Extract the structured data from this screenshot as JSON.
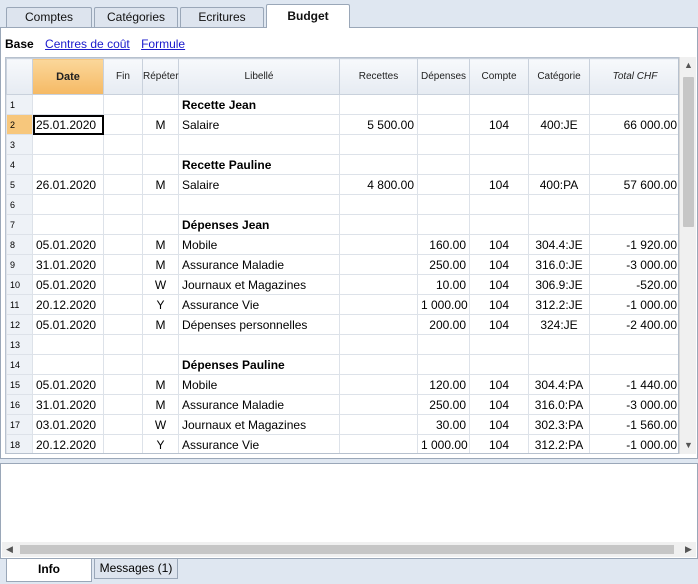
{
  "tabs": [
    "Comptes",
    "Catégories",
    "Ecritures",
    "Budget"
  ],
  "subnav": {
    "base": "Base",
    "links": [
      "Centres de coût",
      "Formule"
    ]
  },
  "columns": {
    "date": "Date",
    "fin": "Fin",
    "repeter": "Répéter",
    "libelle": "Libellé",
    "recettes": "Recettes",
    "depenses": "Dépenses",
    "compte": "Compte",
    "categorie": "Catégorie",
    "total": "Total CHF"
  },
  "rows": [
    {
      "n": "1",
      "date": "",
      "rep": "",
      "lib": "Recette Jean",
      "rec": "",
      "dep": "",
      "cpt": "",
      "cat": "",
      "tot": "",
      "head": true
    },
    {
      "n": "2",
      "date": "25.01.2020",
      "rep": "M",
      "lib": "Salaire",
      "rec": "5 500.00",
      "dep": "",
      "cpt": "104",
      "cat": "400:JE",
      "tot": "66 000.00"
    },
    {
      "n": "3",
      "date": "",
      "rep": "",
      "lib": "",
      "rec": "",
      "dep": "",
      "cpt": "",
      "cat": "",
      "tot": ""
    },
    {
      "n": "4",
      "date": "",
      "rep": "",
      "lib": "Recette Pauline",
      "rec": "",
      "dep": "",
      "cpt": "",
      "cat": "",
      "tot": "",
      "head": true
    },
    {
      "n": "5",
      "date": "26.01.2020",
      "rep": "M",
      "lib": "Salaire",
      "rec": "4 800.00",
      "dep": "",
      "cpt": "104",
      "cat": "400:PA",
      "tot": "57 600.00"
    },
    {
      "n": "6",
      "date": "",
      "rep": "",
      "lib": "",
      "rec": "",
      "dep": "",
      "cpt": "",
      "cat": "",
      "tot": ""
    },
    {
      "n": "7",
      "date": "",
      "rep": "",
      "lib": "Dépenses Jean",
      "rec": "",
      "dep": "",
      "cpt": "",
      "cat": "",
      "tot": "",
      "head": true
    },
    {
      "n": "8",
      "date": "05.01.2020",
      "rep": "M",
      "lib": "Mobile",
      "rec": "",
      "dep": "160.00",
      "cpt": "104",
      "cat": "304.4:JE",
      "tot": "-1 920.00"
    },
    {
      "n": "9",
      "date": "31.01.2020",
      "rep": "M",
      "lib": "Assurance Maladie",
      "rec": "",
      "dep": "250.00",
      "cpt": "104",
      "cat": "316.0:JE",
      "tot": "-3 000.00"
    },
    {
      "n": "10",
      "date": "05.01.2020",
      "rep": "W",
      "lib": "Journaux et Magazines",
      "rec": "",
      "dep": "10.00",
      "cpt": "104",
      "cat": "306.9:JE",
      "tot": "-520.00"
    },
    {
      "n": "11",
      "date": "20.12.2020",
      "rep": "Y",
      "lib": "Assurance Vie",
      "rec": "",
      "dep": "1 000.00",
      "cpt": "104",
      "cat": "312.2:JE",
      "tot": "-1 000.00"
    },
    {
      "n": "12",
      "date": "05.01.2020",
      "rep": "M",
      "lib": "Dépenses personnelles",
      "rec": "",
      "dep": "200.00",
      "cpt": "104",
      "cat": "324:JE",
      "tot": "-2 400.00"
    },
    {
      "n": "13",
      "date": "",
      "rep": "",
      "lib": "",
      "rec": "",
      "dep": "",
      "cpt": "",
      "cat": "",
      "tot": ""
    },
    {
      "n": "14",
      "date": "",
      "rep": "",
      "lib": "Dépenses Pauline",
      "rec": "",
      "dep": "",
      "cpt": "",
      "cat": "",
      "tot": "",
      "head": true
    },
    {
      "n": "15",
      "date": "05.01.2020",
      "rep": "M",
      "lib": "Mobile",
      "rec": "",
      "dep": "120.00",
      "cpt": "104",
      "cat": "304.4:PA",
      "tot": "-1 440.00"
    },
    {
      "n": "16",
      "date": "31.01.2020",
      "rep": "M",
      "lib": "Assurance Maladie",
      "rec": "",
      "dep": "250.00",
      "cpt": "104",
      "cat": "316.0:PA",
      "tot": "-3 000.00"
    },
    {
      "n": "17",
      "date": "03.01.2020",
      "rep": "W",
      "lib": "Journaux et Magazines",
      "rec": "",
      "dep": "30.00",
      "cpt": "104",
      "cat": "302.3:PA",
      "tot": "-1 560.00"
    },
    {
      "n": "18",
      "date": "20.12.2020",
      "rep": "Y",
      "lib": "Assurance Vie",
      "rec": "",
      "dep": "1 000.00",
      "cpt": "104",
      "cat": "312.2:PA",
      "tot": "-1 000.00"
    }
  ],
  "bottom_tabs": [
    "Info",
    "Messages (1)"
  ],
  "colors": {
    "negative": "#e00000",
    "selected_header": "#f5b964",
    "link": "#1a1acc"
  }
}
